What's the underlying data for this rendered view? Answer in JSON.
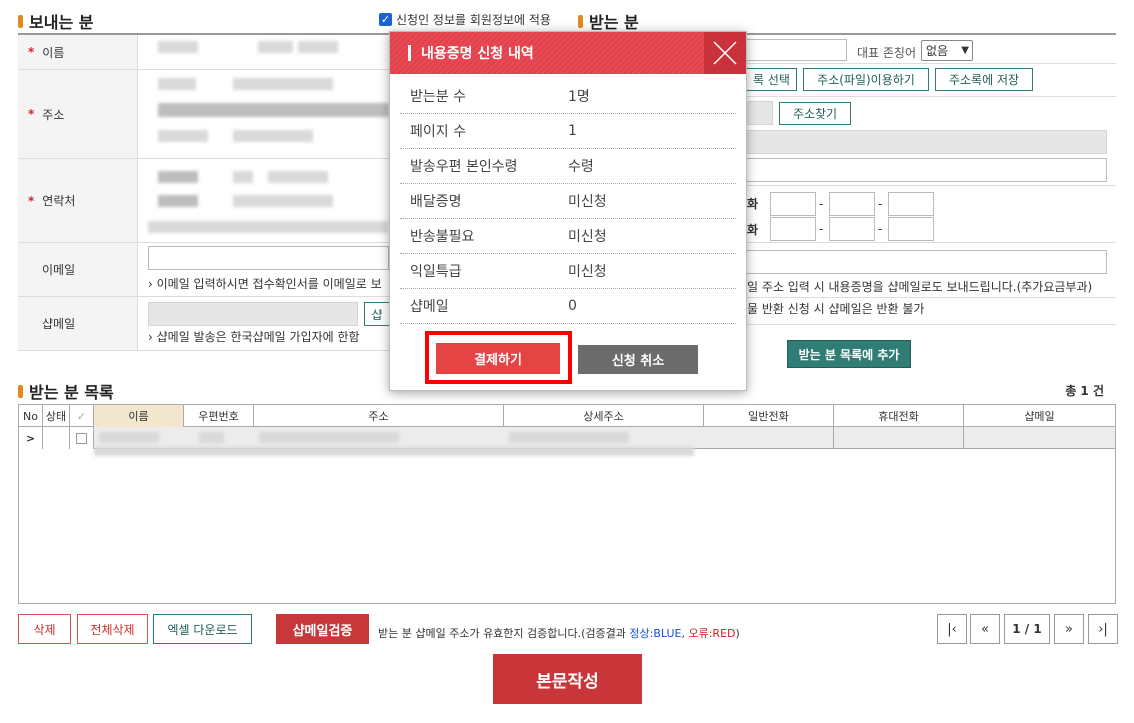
{
  "sender": {
    "title": "보내는 분",
    "apply_checkbox_label": "신청인 정보를 회원정보에 적용",
    "labels": {
      "name": "이름",
      "address": "주소",
      "contact": "연락처",
      "email": "이메일",
      "shopmail": "샵메일"
    },
    "email_note": "› 이메일 입력하시면 접수확인서를 이메일로 보",
    "shopmail_btn": "샵",
    "shopmail_note": "› 샵메일 발송은 한국샵메일 가입자에 한함"
  },
  "receiver": {
    "title": "받는 분",
    "honorific_label": "대표 존칭어",
    "honorific_value": "없음",
    "btn_select": "록 선택",
    "btn_file": "주소(파일)이용하기",
    "btn_save": "주소록에 저장",
    "btn_zip": "주소찾기",
    "phone_label_1": "화",
    "phone_label_2": "화",
    "dash": "-",
    "email_note": "일 주소 입력 시 내용증명을 샵메일로도 보내드립니다.(추가요금부과)",
    "shopmail_note": "물 반환 신청 시 샵메일은 반환 불가",
    "add_btn": "받는 분 목록에 추가"
  },
  "list": {
    "title": "받는 분 목록",
    "total": "총 1 건",
    "columns": [
      "No",
      "상태",
      "✓",
      "이름",
      "우편번호",
      "주소",
      "상세주소",
      "일반전화",
      "휴대전화",
      "샵메일"
    ],
    "row_marker": ">"
  },
  "actions": {
    "delete": "삭제",
    "delete_all": "전체삭제",
    "excel": "엑셀 다운로드",
    "verify": "샵메일검증",
    "verify_note_prefix": "받는 분 샵메일 주소가 유효한지 검증합니다.(검증결과 ",
    "verify_ok": "정상:BLUE",
    "verify_sep": ", ",
    "verify_err": "오류:RED",
    "verify_suffix": ")",
    "page": "1 / 1",
    "compose": "본문작성"
  },
  "modal": {
    "title": "내용증명 신청 내역",
    "rows": [
      {
        "k": "받는분 수",
        "v": "1명"
      },
      {
        "k": "페이지 수",
        "v": "1"
      },
      {
        "k": "발송우편 본인수령",
        "v": "수령"
      },
      {
        "k": "배달증명",
        "v": "미신청"
      },
      {
        "k": "반송불필요",
        "v": "미신청"
      },
      {
        "k": "익일특급",
        "v": "미신청"
      },
      {
        "k": "샵메일",
        "v": "0"
      }
    ],
    "pay": "결제하기",
    "cancel": "신청 취소"
  },
  "colors": {
    "accent": "#e44444",
    "teal": "#2f7d74",
    "verify_ok": "#1a4fd6",
    "verify_err": "#d21f1f"
  }
}
